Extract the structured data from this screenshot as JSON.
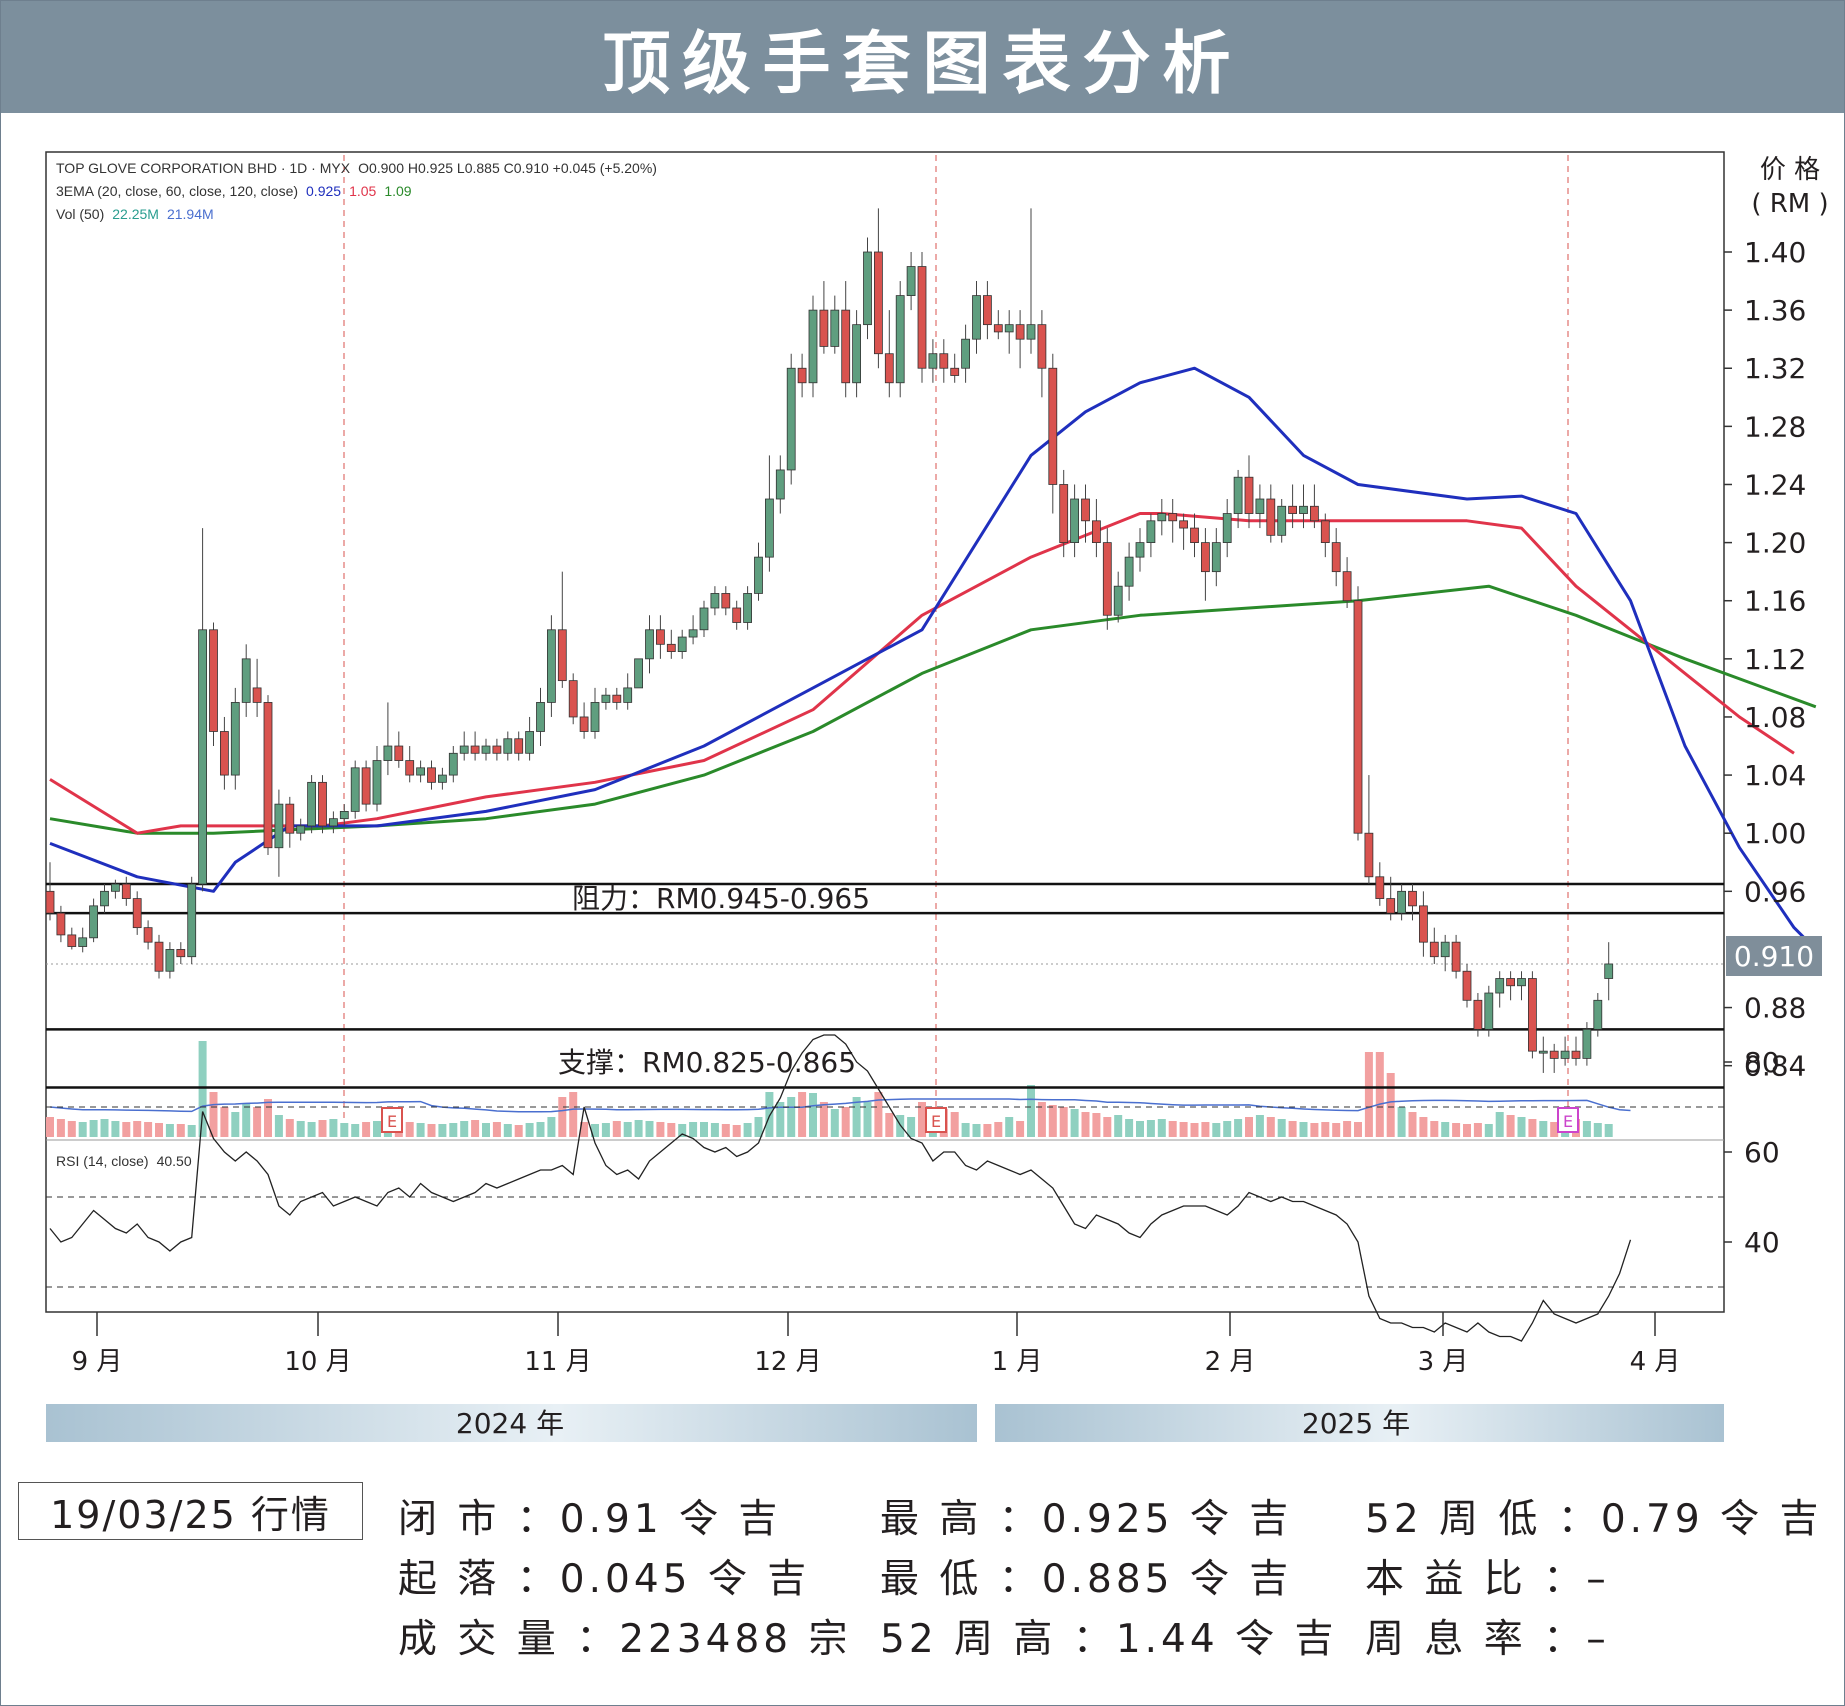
{
  "header": {
    "title": "顶级手套图表分析"
  },
  "chart_data": {
    "type": "candlestick",
    "info": {
      "symbol_line": "TOP GLOVE CORPORATION BHD · 1D · MYX",
      "ohlc": "O0.900  H0.925  L0.885  C0.910  +0.045 (+5.20%)",
      "ema_label": "3EMA (20, close, 60, close, 120, close)",
      "ema_values": [
        "0.925",
        "1.05",
        "1.09"
      ],
      "vol_label": "Vol (50)",
      "vol_values": [
        "22.25M",
        "21.94M"
      ],
      "rsi_label": "RSI (14, close)",
      "rsi_value": "40.50"
    },
    "y_axis": {
      "title_line1": "价 格",
      "title_line2": "( RM )",
      "ticks": [
        "1.40",
        "1.36",
        "1.32",
        "1.28",
        "1.24",
        "1.20",
        "1.16",
        "1.12",
        "1.08",
        "1.04",
        "1.00",
        "0.96",
        "0.88",
        "0.84"
      ],
      "ylim": [
        0.82,
        1.47
      ],
      "last_price": "0.910"
    },
    "rsi_axis": {
      "ticks": [
        "80",
        "60",
        "40"
      ],
      "levels": [
        70,
        50,
        30
      ]
    },
    "x_axis": {
      "months": [
        "9 月",
        "10 月",
        "11 月",
        "12 月",
        "1 月",
        "2 月",
        "3 月",
        "4 月"
      ]
    },
    "years": [
      "2024 年",
      "2025 年"
    ],
    "resistance": {
      "label": "阻力：RM0.945-0.965",
      "low": 0.945,
      "high": 0.965
    },
    "support": {
      "label": "支撑：RM0.825-0.865",
      "low": 0.825,
      "high": 0.865
    },
    "earnings_marker": "E",
    "ema20": [
      [
        0,
        0.993
      ],
      [
        8,
        0.97
      ],
      [
        15,
        0.96
      ],
      [
        17,
        0.98
      ],
      [
        22,
        1.005
      ],
      [
        30,
        1.005
      ],
      [
        40,
        1.015
      ],
      [
        50,
        1.03
      ],
      [
        60,
        1.06
      ],
      [
        70,
        1.1
      ],
      [
        80,
        1.14
      ],
      [
        85,
        1.2
      ],
      [
        90,
        1.26
      ],
      [
        95,
        1.29
      ],
      [
        100,
        1.31
      ],
      [
        105,
        1.32
      ],
      [
        110,
        1.3
      ],
      [
        115,
        1.26
      ],
      [
        120,
        1.24
      ],
      [
        130,
        1.23
      ],
      [
        135,
        1.232
      ],
      [
        140,
        1.22
      ],
      [
        145,
        1.16
      ],
      [
        150,
        1.06
      ],
      [
        155,
        0.99
      ],
      [
        160,
        0.935
      ],
      [
        162,
        0.92
      ]
    ],
    "ema60": [
      [
        0,
        1.037
      ],
      [
        8,
        1.0
      ],
      [
        12,
        1.005
      ],
      [
        15,
        1.005
      ],
      [
        25,
        1.005
      ],
      [
        30,
        1.01
      ],
      [
        40,
        1.025
      ],
      [
        50,
        1.035
      ],
      [
        60,
        1.05
      ],
      [
        70,
        1.085
      ],
      [
        80,
        1.15
      ],
      [
        90,
        1.19
      ],
      [
        100,
        1.22
      ],
      [
        102,
        1.22
      ],
      [
        110,
        1.215
      ],
      [
        120,
        1.215
      ],
      [
        130,
        1.215
      ],
      [
        135,
        1.21
      ],
      [
        140,
        1.17
      ],
      [
        145,
        1.14
      ],
      [
        150,
        1.11
      ],
      [
        155,
        1.08
      ],
      [
        160,
        1.055
      ]
    ],
    "ema120": [
      [
        0,
        1.01
      ],
      [
        8,
        1.0
      ],
      [
        15,
        1.0
      ],
      [
        30,
        1.005
      ],
      [
        40,
        1.01
      ],
      [
        50,
        1.02
      ],
      [
        60,
        1.04
      ],
      [
        70,
        1.07
      ],
      [
        80,
        1.11
      ],
      [
        90,
        1.14
      ],
      [
        100,
        1.15
      ],
      [
        110,
        1.155
      ],
      [
        120,
        1.16
      ],
      [
        132,
        1.17
      ],
      [
        140,
        1.15
      ],
      [
        150,
        1.12
      ],
      [
        162,
        1.087
      ]
    ],
    "candles": [
      [
        0,
        0.96,
        0.98,
        0.945,
        0.94
      ],
      [
        1,
        0.945,
        0.95,
        0.93,
        0.925
      ],
      [
        2,
        0.93,
        0.935,
        0.922,
        0.92
      ],
      [
        3,
        0.922,
        0.935,
        0.928,
        0.918
      ],
      [
        4,
        0.928,
        0.955,
        0.95,
        0.925
      ],
      [
        5,
        0.95,
        0.965,
        0.96,
        0.945
      ],
      [
        6,
        0.96,
        0.968,
        0.965,
        0.955
      ],
      [
        7,
        0.965,
        0.97,
        0.955,
        0.95
      ],
      [
        8,
        0.955,
        0.96,
        0.935,
        0.93
      ],
      [
        9,
        0.935,
        0.94,
        0.925,
        0.92
      ],
      [
        10,
        0.925,
        0.93,
        0.905,
        0.9
      ],
      [
        11,
        0.905,
        0.925,
        0.92,
        0.9
      ],
      [
        12,
        0.92,
        0.925,
        0.915,
        0.91
      ],
      [
        13,
        0.915,
        0.97,
        0.965,
        0.91
      ],
      [
        14,
        0.965,
        1.21,
        1.14,
        0.96
      ],
      [
        15,
        1.14,
        1.145,
        1.07,
        1.06
      ],
      [
        16,
        1.07,
        1.08,
        1.04,
        1.03
      ],
      [
        17,
        1.04,
        1.1,
        1.09,
        1.03
      ],
      [
        18,
        1.09,
        1.13,
        1.12,
        1.08
      ],
      [
        19,
        1.1,
        1.12,
        1.09,
        1.08
      ],
      [
        20,
        1.09,
        1.095,
        0.99,
        0.985
      ],
      [
        21,
        0.99,
        1.03,
        1.02,
        0.97
      ],
      [
        22,
        1.02,
        1.025,
        1.0,
        0.99
      ],
      [
        23,
        1.0,
        1.01,
        1.005,
        0.995
      ],
      [
        24,
        1.005,
        1.04,
        1.035,
        1.0
      ],
      [
        25,
        1.035,
        1.04,
        1.005,
        1.0
      ],
      [
        26,
        1.005,
        1.015,
        1.01,
        1.0
      ],
      [
        27,
        1.01,
        1.02,
        1.015,
        1.005
      ],
      [
        28,
        1.015,
        1.05,
        1.045,
        1.01
      ],
      [
        29,
        1.045,
        1.05,
        1.02,
        1.015
      ],
      [
        30,
        1.02,
        1.06,
        1.05,
        1.015
      ],
      [
        31,
        1.05,
        1.09,
        1.06,
        1.04
      ],
      [
        32,
        1.06,
        1.07,
        1.05,
        1.045
      ],
      [
        33,
        1.05,
        1.06,
        1.04,
        1.035
      ],
      [
        34,
        1.04,
        1.05,
        1.045,
        1.035
      ],
      [
        35,
        1.045,
        1.05,
        1.035,
        1.03
      ],
      [
        36,
        1.035,
        1.045,
        1.04,
        1.03
      ],
      [
        37,
        1.04,
        1.06,
        1.055,
        1.035
      ],
      [
        38,
        1.055,
        1.07,
        1.06,
        1.05
      ],
      [
        39,
        1.06,
        1.07,
        1.055,
        1.05
      ],
      [
        40,
        1.055,
        1.065,
        1.06,
        1.05
      ],
      [
        41,
        1.06,
        1.065,
        1.055,
        1.05
      ],
      [
        42,
        1.055,
        1.07,
        1.065,
        1.05
      ],
      [
        43,
        1.065,
        1.07,
        1.055,
        1.05
      ],
      [
        44,
        1.055,
        1.08,
        1.07,
        1.05
      ],
      [
        45,
        1.07,
        1.1,
        1.09,
        1.06
      ],
      [
        46,
        1.09,
        1.15,
        1.14,
        1.08
      ],
      [
        47,
        1.14,
        1.18,
        1.105,
        1.1
      ],
      [
        48,
        1.105,
        1.11,
        1.08,
        1.075
      ],
      [
        49,
        1.08,
        1.09,
        1.07,
        1.065
      ],
      [
        50,
        1.07,
        1.1,
        1.09,
        1.065
      ],
      [
        51,
        1.09,
        1.1,
        1.095,
        1.085
      ],
      [
        52,
        1.095,
        1.1,
        1.09,
        1.085
      ],
      [
        53,
        1.09,
        1.11,
        1.1,
        1.085
      ],
      [
        54,
        1.1,
        1.12,
        1.12,
        1.1
      ],
      [
        55,
        1.12,
        1.15,
        1.14,
        1.11
      ],
      [
        56,
        1.14,
        1.15,
        1.13,
        1.12
      ],
      [
        57,
        1.13,
        1.14,
        1.125,
        1.12
      ],
      [
        58,
        1.125,
        1.14,
        1.135,
        1.12
      ],
      [
        59,
        1.135,
        1.15,
        1.14,
        1.13
      ],
      [
        60,
        1.14,
        1.16,
        1.155,
        1.135
      ],
      [
        61,
        1.155,
        1.17,
        1.165,
        1.15
      ],
      [
        62,
        1.165,
        1.17,
        1.155,
        1.15
      ],
      [
        63,
        1.155,
        1.16,
        1.145,
        1.14
      ],
      [
        64,
        1.145,
        1.17,
        1.165,
        1.14
      ],
      [
        65,
        1.165,
        1.2,
        1.19,
        1.16
      ],
      [
        66,
        1.19,
        1.26,
        1.23,
        1.18
      ],
      [
        67,
        1.23,
        1.26,
        1.25,
        1.22
      ],
      [
        68,
        1.25,
        1.33,
        1.32,
        1.24
      ],
      [
        69,
        1.32,
        1.33,
        1.31,
        1.3
      ],
      [
        70,
        1.31,
        1.37,
        1.36,
        1.3
      ],
      [
        71,
        1.36,
        1.38,
        1.335,
        1.33
      ],
      [
        72,
        1.335,
        1.37,
        1.36,
        1.33
      ],
      [
        73,
        1.36,
        1.38,
        1.31,
        1.3
      ],
      [
        74,
        1.31,
        1.36,
        1.35,
        1.3
      ],
      [
        75,
        1.35,
        1.41,
        1.4,
        1.34
      ],
      [
        76,
        1.4,
        1.43,
        1.33,
        1.32
      ],
      [
        77,
        1.33,
        1.36,
        1.31,
        1.3
      ],
      [
        78,
        1.31,
        1.38,
        1.37,
        1.3
      ],
      [
        79,
        1.37,
        1.4,
        1.39,
        1.36
      ],
      [
        80,
        1.39,
        1.4,
        1.32,
        1.31
      ],
      [
        81,
        1.32,
        1.34,
        1.33,
        1.31
      ],
      [
        82,
        1.33,
        1.34,
        1.32,
        1.31
      ],
      [
        83,
        1.32,
        1.33,
        1.315,
        1.31
      ],
      [
        84,
        1.32,
        1.35,
        1.34,
        1.31
      ],
      [
        85,
        1.34,
        1.38,
        1.37,
        1.33
      ],
      [
        86,
        1.37,
        1.38,
        1.35,
        1.34
      ],
      [
        87,
        1.35,
        1.36,
        1.345,
        1.34
      ],
      [
        88,
        1.345,
        1.36,
        1.35,
        1.33
      ],
      [
        89,
        1.35,
        1.36,
        1.34,
        1.32
      ],
      [
        90,
        1.34,
        1.43,
        1.35,
        1.33
      ],
      [
        91,
        1.35,
        1.36,
        1.32,
        1.3
      ],
      [
        92,
        1.32,
        1.33,
        1.24,
        1.22
      ],
      [
        93,
        1.24,
        1.25,
        1.2,
        1.19
      ],
      [
        94,
        1.2,
        1.24,
        1.23,
        1.19
      ],
      [
        95,
        1.23,
        1.24,
        1.215,
        1.2
      ],
      [
        96,
        1.215,
        1.23,
        1.2,
        1.19
      ],
      [
        97,
        1.2,
        1.21,
        1.15,
        1.14
      ],
      [
        98,
        1.15,
        1.18,
        1.17,
        1.145
      ],
      [
        99,
        1.17,
        1.2,
        1.19,
        1.16
      ],
      [
        100,
        1.19,
        1.21,
        1.2,
        1.18
      ],
      [
        101,
        1.2,
        1.22,
        1.215,
        1.19
      ],
      [
        102,
        1.215,
        1.23,
        1.22,
        1.205
      ],
      [
        103,
        1.22,
        1.23,
        1.215,
        1.2
      ],
      [
        104,
        1.215,
        1.22,
        1.21,
        1.195
      ],
      [
        105,
        1.21,
        1.22,
        1.2,
        1.19
      ],
      [
        106,
        1.2,
        1.21,
        1.18,
        1.16
      ],
      [
        107,
        1.18,
        1.21,
        1.2,
        1.17
      ],
      [
        108,
        1.2,
        1.23,
        1.22,
        1.19
      ],
      [
        109,
        1.22,
        1.25,
        1.245,
        1.21
      ],
      [
        110,
        1.245,
        1.26,
        1.22,
        1.21
      ],
      [
        111,
        1.22,
        1.24,
        1.23,
        1.21
      ],
      [
        112,
        1.23,
        1.24,
        1.205,
        1.2
      ],
      [
        113,
        1.205,
        1.23,
        1.225,
        1.2
      ],
      [
        114,
        1.225,
        1.24,
        1.22,
        1.21
      ],
      [
        115,
        1.22,
        1.24,
        1.225,
        1.21
      ],
      [
        116,
        1.225,
        1.24,
        1.215,
        1.21
      ],
      [
        117,
        1.215,
        1.22,
        1.2,
        1.19
      ],
      [
        118,
        1.2,
        1.21,
        1.18,
        1.17
      ],
      [
        119,
        1.18,
        1.19,
        1.16,
        1.155
      ],
      [
        120,
        1.16,
        1.17,
        1.0,
        0.995
      ],
      [
        121,
        1.0,
        1.04,
        0.97,
        0.965
      ],
      [
        122,
        0.97,
        0.98,
        0.955,
        0.95
      ],
      [
        123,
        0.955,
        0.97,
        0.945,
        0.94
      ],
      [
        124,
        0.945,
        0.965,
        0.96,
        0.94
      ],
      [
        125,
        0.96,
        0.965,
        0.95,
        0.94
      ],
      [
        126,
        0.95,
        0.96,
        0.925,
        0.915
      ],
      [
        127,
        0.925,
        0.935,
        0.915,
        0.91
      ],
      [
        128,
        0.915,
        0.93,
        0.925,
        0.905
      ],
      [
        129,
        0.925,
        0.93,
        0.905,
        0.9
      ],
      [
        130,
        0.905,
        0.91,
        0.885,
        0.88
      ],
      [
        131,
        0.885,
        0.89,
        0.865,
        0.86
      ],
      [
        132,
        0.865,
        0.895,
        0.89,
        0.86
      ],
      [
        133,
        0.89,
        0.905,
        0.9,
        0.88
      ],
      [
        134,
        0.9,
        0.905,
        0.895,
        0.885
      ],
      [
        135,
        0.895,
        0.905,
        0.9,
        0.885
      ],
      [
        136,
        0.9,
        0.905,
        0.85,
        0.845
      ],
      [
        137,
        0.85,
        0.86,
        0.85,
        0.835
      ],
      [
        138,
        0.85,
        0.855,
        0.845,
        0.835
      ],
      [
        139,
        0.845,
        0.86,
        0.85,
        0.84
      ],
      [
        140,
        0.85,
        0.86,
        0.845,
        0.84
      ],
      [
        141,
        0.845,
        0.87,
        0.865,
        0.84
      ],
      [
        142,
        0.865,
        0.89,
        0.885,
        0.86
      ],
      [
        143,
        0.9,
        0.925,
        0.91,
        0.885
      ]
    ],
    "volume": [
      20,
      18,
      16,
      15,
      17,
      18,
      16,
      15,
      16,
      15,
      14,
      13,
      13,
      12,
      96,
      45,
      30,
      25,
      34,
      30,
      38,
      22,
      18,
      16,
      15,
      17,
      18,
      14,
      13,
      15,
      16,
      28,
      14,
      15,
      14,
      13,
      13,
      14,
      16,
      17,
      14,
      15,
      13,
      12,
      14,
      15,
      20,
      40,
      45,
      15,
      13,
      14,
      16,
      15,
      17,
      16,
      15,
      14,
      13,
      15,
      15,
      14,
      13,
      12,
      14,
      20,
      45,
      35,
      40,
      45,
      44,
      35,
      28,
      30,
      40,
      35,
      45,
      24,
      22,
      20,
      35,
      30,
      28,
      25,
      14,
      13,
      13,
      15,
      20,
      16,
      52,
      35,
      32,
      30,
      28,
      25,
      24,
      20,
      22,
      18,
      16,
      17,
      18,
      16,
      15,
      14,
      15,
      14,
      16,
      18,
      20,
      22,
      20,
      18,
      16,
      15,
      14,
      15,
      14,
      16,
      15,
      85,
      85,
      64,
      30,
      25,
      20,
      16,
      15,
      14,
      13,
      14,
      13,
      25,
      22,
      20,
      18,
      16,
      15,
      14,
      18,
      16,
      14,
      13,
      13,
      12
    ]
  },
  "rsi_series": [
    43,
    40,
    41,
    44,
    47,
    45,
    43,
    42,
    44,
    41,
    40,
    38,
    40,
    41,
    69,
    63,
    60,
    58,
    60,
    58,
    55,
    48,
    46,
    49,
    50,
    51,
    48,
    49,
    50,
    49,
    48,
    51,
    52,
    50,
    53,
    51,
    50,
    49,
    50,
    51,
    53,
    52,
    53,
    54,
    55,
    56,
    56,
    57,
    55,
    70,
    62,
    57,
    55,
    56,
    54,
    58,
    60,
    62,
    64,
    63,
    61,
    60,
    61,
    59,
    60,
    62,
    68,
    72,
    78,
    82,
    85,
    86,
    86,
    84,
    80,
    78,
    74,
    70,
    66,
    63,
    62,
    58,
    60,
    60,
    57,
    56,
    58,
    57,
    56,
    55,
    56,
    54,
    52,
    48,
    44,
    43,
    46,
    45,
    44,
    42,
    41,
    44,
    46,
    47,
    48,
    48,
    48,
    47,
    46,
    48,
    51,
    50,
    49,
    50,
    49,
    49,
    48,
    47,
    46,
    44,
    40,
    28,
    23,
    22,
    22,
    21,
    21,
    20,
    22,
    21,
    20,
    22,
    20,
    19,
    19,
    18,
    22,
    27,
    24,
    23,
    22,
    23,
    24,
    28,
    33,
    40.5
  ],
  "stats": {
    "date": "19/03/25 行情",
    "close": "闭 市 ：0.91 令 吉",
    "change": "起 落 ：0.045 令 吉",
    "volume": "成 交 量 ：223488 宗",
    "high": "最 高 ：0.925 令 吉",
    "low": "最 低 ：0.885 令 吉",
    "high52": "52 周 高 ：1.44 令 吉",
    "low52": "52 周 低 ：0.79 令 吉",
    "pe": "本 益 比 ：–",
    "dy": "周 息 率 ：–"
  },
  "colors": {
    "up": "#5f9e7f",
    "down": "#d9534f",
    "volUp": "#8fd0c0",
    "volDown": "#f2a0a0",
    "ema20": "#1f2fbd",
    "ema60": "#e0344a",
    "ema120": "#2a8a2a",
    "title_bg": "#7c8f9d",
    "last_price_bg": "#7f8e9a"
  }
}
